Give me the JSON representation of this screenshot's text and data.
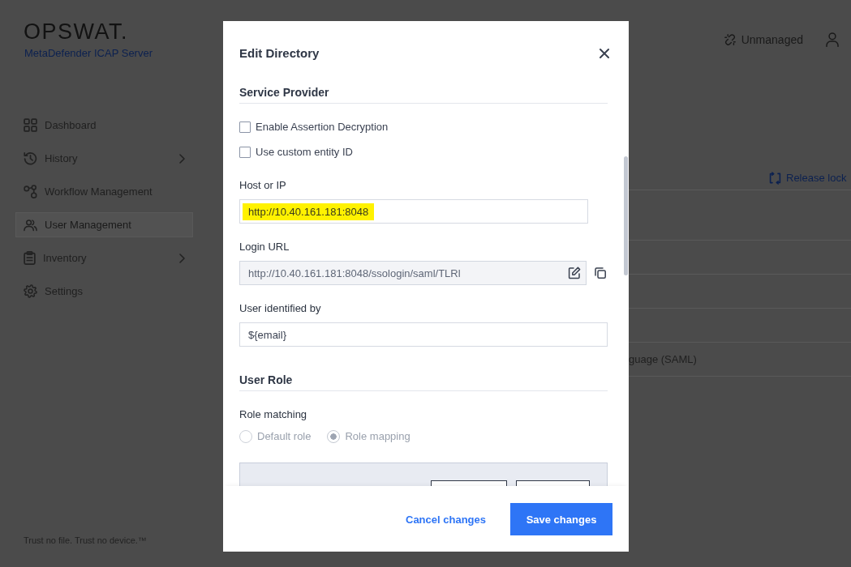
{
  "header": {
    "logo": "OPSWAT.",
    "product": "MetaDefender ICAP Server",
    "status": "Unmanaged"
  },
  "sidebar": {
    "items": [
      {
        "label": "Dashboard",
        "expandable": false,
        "selected": false
      },
      {
        "label": "History",
        "expandable": true,
        "selected": false
      },
      {
        "label": "Workflow Management",
        "expandable": false,
        "selected": false
      },
      {
        "label": "User Management",
        "expandable": false,
        "selected": true
      },
      {
        "label": "Inventory",
        "expandable": true,
        "selected": false
      },
      {
        "label": "Settings",
        "expandable": false,
        "selected": false
      }
    ],
    "tagline": "Trust no file. Trust no device.™"
  },
  "content": {
    "release_link": "Release lock",
    "table": {
      "rows": [
        {
          "column_1": "guage (SAML)"
        }
      ]
    }
  },
  "dialog": {
    "title": "Edit Directory",
    "sections": [
      {
        "title": "Service Provider",
        "fields": [
          {
            "kind": "checkbox",
            "label": "Enable Assertion Decryption",
            "checked": false
          },
          {
            "kind": "checkbox",
            "label": "Use custom entity ID",
            "checked": false
          },
          {
            "kind": "short_text",
            "label": "Host or IP",
            "value": "http://10.40.161.181:8048",
            "highlighted": true,
            "disabled": false
          },
          {
            "kind": "url",
            "label": "Login URL",
            "value": "http://10.40.161.181:8048/ssologin/saml/TLRl",
            "disabled": true
          },
          {
            "kind": "text",
            "label": "User identified by",
            "value": "${email}",
            "highlighted": false,
            "disabled": false
          }
        ]
      },
      {
        "title": "User Role",
        "fields": [
          {
            "kind": "radio",
            "label": "Role matching",
            "disabled": true,
            "options": [
              {
                "label": "Default role",
                "selected": false
              },
              {
                "label": "Role mapping",
                "selected": true
              }
            ]
          },
          {
            "kind": "panel"
          }
        ]
      }
    ],
    "buttons": [
      {
        "kind": "link",
        "label": "Cancel changes"
      },
      {
        "kind": "primary",
        "label": "Save changes"
      }
    ]
  }
}
